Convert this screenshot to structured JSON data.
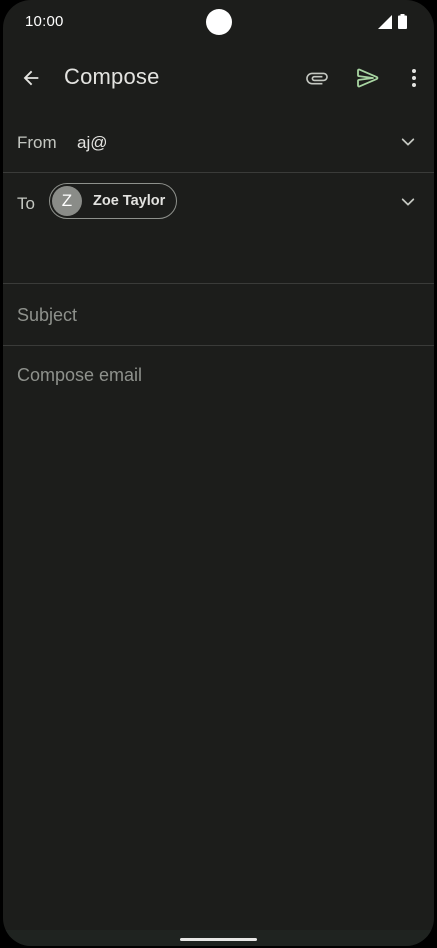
{
  "status_bar": {
    "time": "10:00",
    "icons": [
      "camera-cutout",
      "signal-icon",
      "battery-icon"
    ]
  },
  "app_bar": {
    "title": "Compose",
    "icons": [
      "back-arrow-icon",
      "attach-icon",
      "send-icon",
      "more-vert-icon"
    ]
  },
  "from": {
    "label": "From",
    "value": "aj@"
  },
  "to": {
    "label": "To",
    "recipient": {
      "initial": "Z",
      "name": "Zoe Taylor"
    }
  },
  "subject": {
    "placeholder": "Subject",
    "value": ""
  },
  "body": {
    "placeholder": "Compose email",
    "value": ""
  },
  "colors": {
    "background": "#1c1d1b",
    "send_accent": "#a8d5a2",
    "text": "#e3e3e0",
    "placeholder": "#8e918c",
    "divider": "#3a3b39"
  }
}
